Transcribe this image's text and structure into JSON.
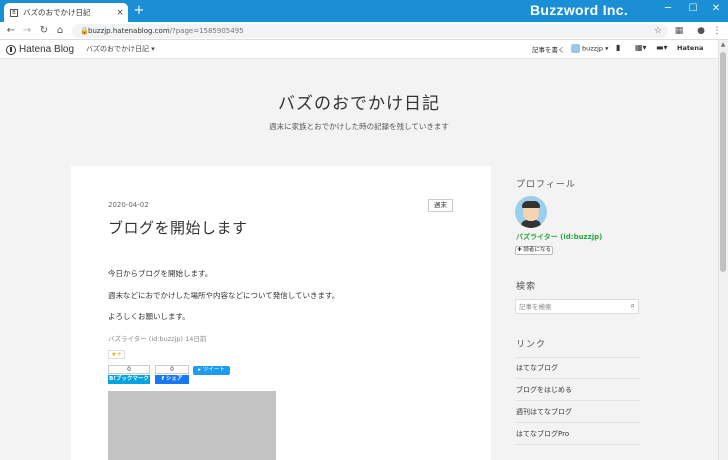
{
  "browser": {
    "tab_title": "バズのおでかけ日記",
    "tab_close": "×",
    "new_tab": "+",
    "brand": "Buzzword Inc.",
    "url_host": "buzzjp.hatenablog.com",
    "url_path": "/?page=1585905495",
    "win_min": "─",
    "win_max": "☐",
    "win_close": "✕"
  },
  "hatena_bar": {
    "logo": "Hatena Blog",
    "blog_name": "バズのおでかけ日記 ▾",
    "write": "記事を書く",
    "user": "buzzjp ▾",
    "hatena": "Hatena"
  },
  "blog": {
    "title": "バズのおでかけ日記",
    "description": "週末に家族とおでかけした時の記録を残していきます"
  },
  "entry": {
    "date": "2020-04-02",
    "category": "週末",
    "title": "ブログを開始します",
    "paragraphs": [
      "今日からブログを開始します。",
      "週末などにおでかけした場所や内容などについて発信していきます。",
      "よろしくお願いします。"
    ],
    "footer": "バズライター (id:buzzjp) 14日前",
    "star": "★+",
    "bookmark_count": "0",
    "bookmark_label": "B!ブックマーク",
    "share_count": "0",
    "share_label": "f シェア",
    "tweet_label": "ツイート"
  },
  "sidebar": {
    "profile_heading": "プロフィール",
    "profile_name": "バズライター (id:buzzjp)",
    "reader_button": "✚ 読者になる",
    "search_heading": "検索",
    "search_placeholder": "記事を検索",
    "links_heading": "リンク",
    "links": [
      "はてなブログ",
      "ブログをはじめる",
      "週刊はてなブログ",
      "はてなブログPro"
    ]
  },
  "colors": {
    "titlebar": "#1a8fd6",
    "profile_name": "#28a745",
    "share_facebook": "#1877f2",
    "bookmark": "#00a4de"
  }
}
